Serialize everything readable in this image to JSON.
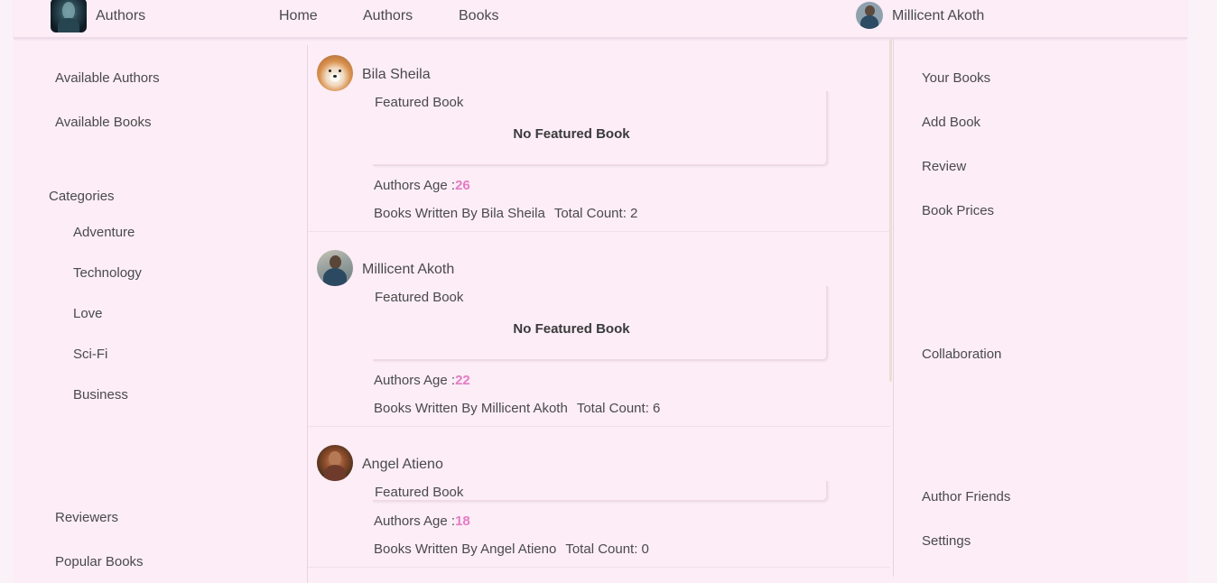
{
  "navbar": {
    "brand": "Authors",
    "links": [
      "Home",
      "Authors",
      "Books"
    ],
    "user_name": "Millicent Akoth"
  },
  "left_sidebar": {
    "top_links": [
      "Available Authors",
      "Available Books"
    ],
    "categories_title": "Categories",
    "categories": [
      "Adventure",
      "Technology",
      "Love",
      "Sci-Fi",
      "Business"
    ],
    "bottom_links": [
      "Reviewers",
      "Popular Books"
    ]
  },
  "authors": [
    {
      "name": "Bila Sheila",
      "featured_label": "Featured Book",
      "featured_value": "No Featured Book",
      "age_label": "Authors Age :",
      "age": "26",
      "written_label": "Books Written By Bila Sheila",
      "count_label": "Total Count: 2"
    },
    {
      "name": "Millicent Akoth",
      "featured_label": "Featured Book",
      "featured_value": "No Featured Book",
      "age_label": "Authors Age :",
      "age": "22",
      "written_label": "Books Written By Millicent Akoth",
      "count_label": "Total Count: 6"
    },
    {
      "name": "Angel Atieno",
      "featured_label": "Featured Book",
      "featured_value": "",
      "age_label": "Authors Age :",
      "age": "18",
      "written_label": "Books Written By Angel Atieno",
      "count_label": "Total Count: 0"
    }
  ],
  "right_sidebar": {
    "links": [
      "Your Books",
      "Add Book",
      "Review",
      "Book Prices",
      "Collaboration",
      "Author Friends",
      "Settings"
    ]
  },
  "colors": {
    "accent": "#e57bc3",
    "background": "#fcedf7"
  }
}
